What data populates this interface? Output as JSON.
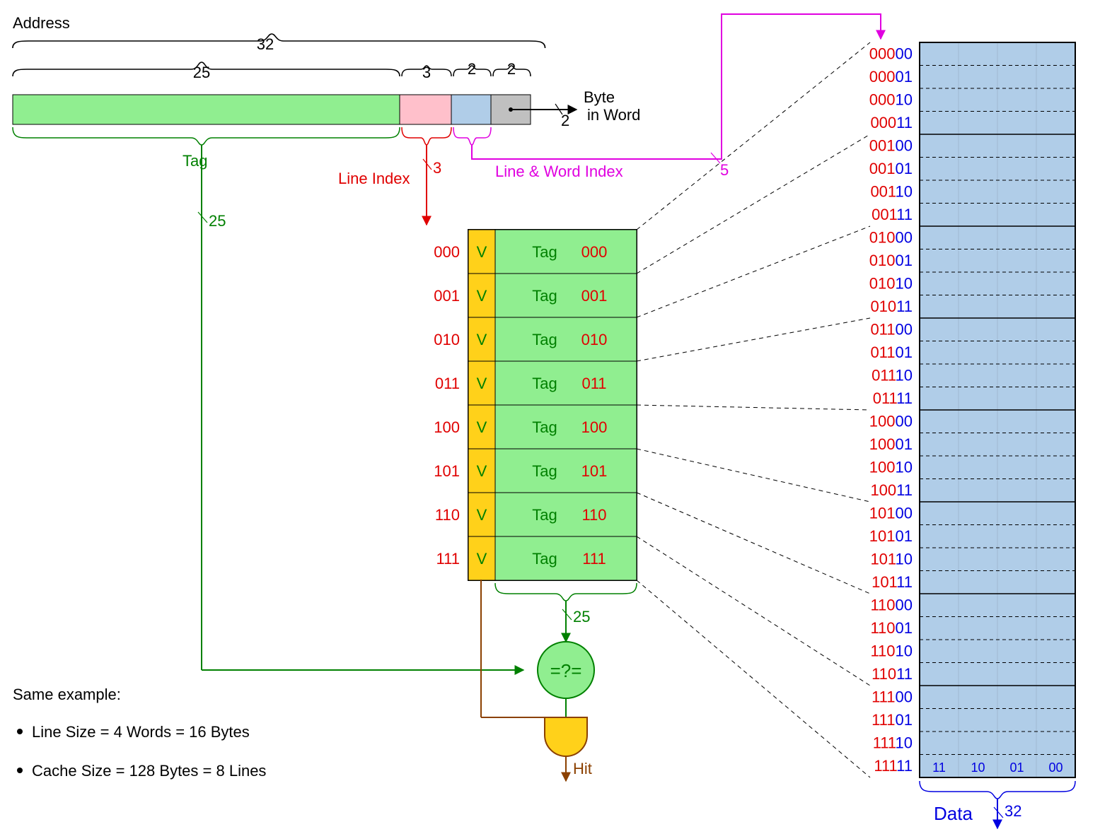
{
  "title": "Address",
  "address": {
    "total_bits": 32,
    "tag_bits": 25,
    "line_index_bits": 3,
    "word_bits": 2,
    "byte_bits": 2,
    "byte_in_word": "Byte in Word",
    "byte_count": "2",
    "line_word_index": "Line & Word Index",
    "line_word_bits": "5",
    "tag_label": "Tag",
    "line_index_label": "Line Index"
  },
  "cache": {
    "v": "V",
    "tag": "Tag",
    "rows": [
      "000",
      "001",
      "010",
      "011",
      "100",
      "101",
      "110",
      "111"
    ],
    "tag_width": "25"
  },
  "compare": "=?=",
  "hit": "Hit",
  "data": {
    "label": "Data",
    "width": "32",
    "footer": [
      "11",
      "10",
      "01",
      "00"
    ],
    "rows": [
      [
        "000",
        "00"
      ],
      [
        "000",
        "01"
      ],
      [
        "000",
        "10"
      ],
      [
        "000",
        "11"
      ],
      [
        "001",
        "00"
      ],
      [
        "001",
        "01"
      ],
      [
        "001",
        "10"
      ],
      [
        "001",
        "11"
      ],
      [
        "010",
        "00"
      ],
      [
        "010",
        "01"
      ],
      [
        "010",
        "10"
      ],
      [
        "010",
        "11"
      ],
      [
        "011",
        "00"
      ],
      [
        "011",
        "01"
      ],
      [
        "011",
        "10"
      ],
      [
        "011",
        "11"
      ],
      [
        "100",
        "00"
      ],
      [
        "100",
        "01"
      ],
      [
        "100",
        "10"
      ],
      [
        "100",
        "11"
      ],
      [
        "101",
        "00"
      ],
      [
        "101",
        "01"
      ],
      [
        "101",
        "10"
      ],
      [
        "101",
        "11"
      ],
      [
        "110",
        "00"
      ],
      [
        "110",
        "01"
      ],
      [
        "110",
        "10"
      ],
      [
        "110",
        "11"
      ],
      [
        "111",
        "00"
      ],
      [
        "111",
        "01"
      ],
      [
        "111",
        "10"
      ],
      [
        "111",
        "11"
      ]
    ]
  },
  "example": {
    "title": "Same example:",
    "items": [
      "Line Size = 4 Words = 16 Bytes",
      "Cache Size = 128 Bytes = 8 Lines"
    ]
  }
}
